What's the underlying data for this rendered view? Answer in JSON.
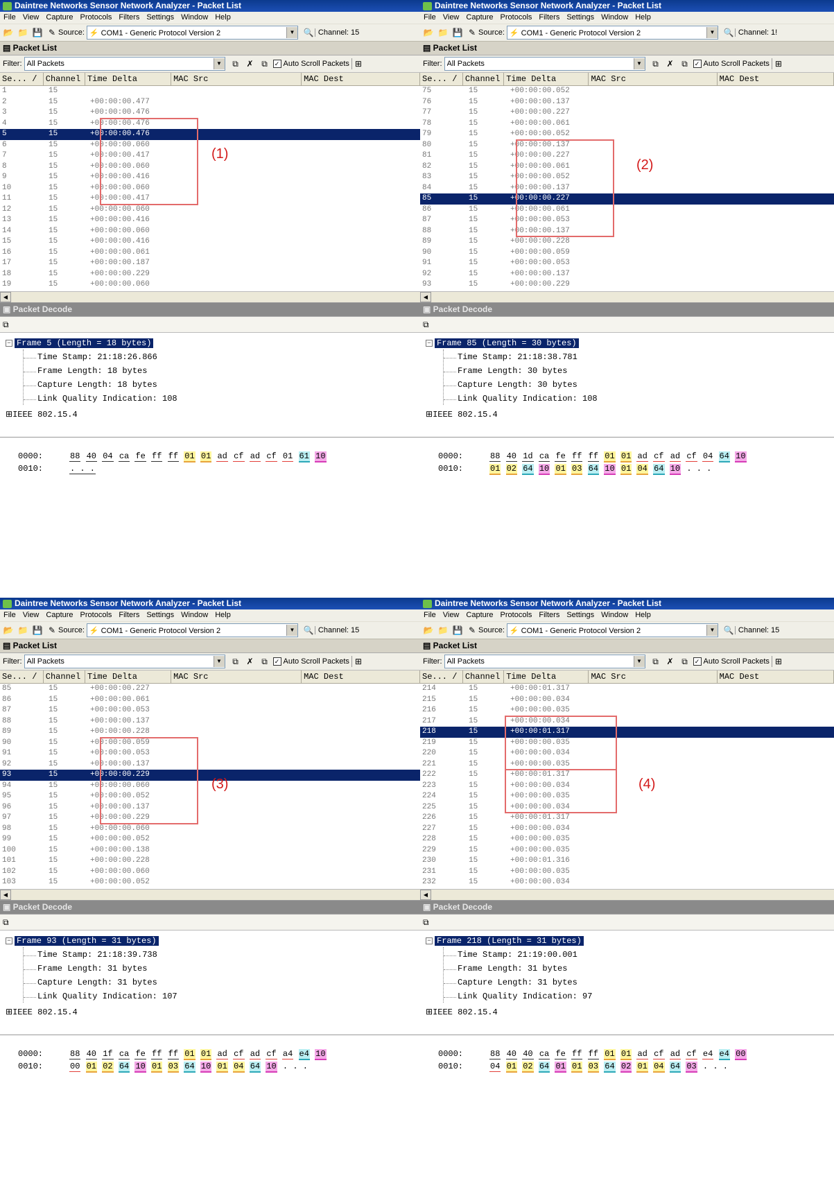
{
  "window": {
    "title": "Daintree Networks Sensor Network Analyzer - Packet List",
    "menu": [
      "File",
      "View",
      "Capture",
      "Protocols",
      "Filters",
      "Settings",
      "Window",
      "Help"
    ],
    "source_label": "Source:",
    "source_value": "COM1 - Generic Protocol Version 2",
    "channel_label": "Channel:"
  },
  "labels": {
    "packet_list": "Packet List",
    "filter_label": "Filter:",
    "filter_value": "All Packets",
    "auto_scroll": "Auto Scroll Packets",
    "packet_decode": "Packet Decode",
    "columns": [
      "Se... /",
      "Channel",
      "Time Delta",
      "MAC Src",
      "MAC Dest"
    ],
    "ieee": "IEEE 802.15.4"
  },
  "panels": [
    {
      "channel_cut": "15",
      "annotation": "(1)",
      "rows": [
        [
          "1",
          "15",
          ""
        ],
        [
          "2",
          "15",
          "+00:00:00.477"
        ],
        [
          "3",
          "15",
          "+00:00:00.476"
        ],
        [
          "4",
          "15",
          "+00:00:00.476"
        ],
        [
          "5",
          "15",
          "+00:00:00.476"
        ],
        [
          "6",
          "15",
          "+00:00:00.060"
        ],
        [
          "7",
          "15",
          "+00:00:00.417"
        ],
        [
          "8",
          "15",
          "+00:00:00.060"
        ],
        [
          "9",
          "15",
          "+00:00:00.416"
        ],
        [
          "10",
          "15",
          "+00:00:00.060"
        ],
        [
          "11",
          "15",
          "+00:00:00.417"
        ],
        [
          "12",
          "15",
          "+00:00:00.060"
        ],
        [
          "13",
          "15",
          "+00:00:00.416"
        ],
        [
          "14",
          "15",
          "+00:00:00.060"
        ],
        [
          "15",
          "15",
          "+00:00:00.416"
        ],
        [
          "16",
          "15",
          "+00:00:00.061"
        ],
        [
          "17",
          "15",
          "+00:00:00.187"
        ],
        [
          "18",
          "15",
          "+00:00:00.229"
        ],
        [
          "19",
          "15",
          "+00:00:00.060"
        ]
      ],
      "selected": 4,
      "frame": "Frame 5 (Length = 18 bytes)",
      "fields": [
        "Time Stamp: 21:18:26.866",
        "Frame Length: 18 bytes",
        "Capture Length: 18 bytes",
        "Link Quality Indication: 108"
      ],
      "hex": [
        {
          "off": "0000:",
          "bytes": [
            [
              "88",
              "u"
            ],
            [
              "40",
              "u"
            ],
            [
              "04",
              "u"
            ],
            [
              "ca",
              "u"
            ],
            [
              "fe",
              "u"
            ],
            [
              "ff",
              "u"
            ],
            [
              "ff",
              "u"
            ],
            [
              "01",
              "y"
            ],
            [
              "01",
              "y"
            ],
            [
              "ad",
              "ur"
            ],
            [
              "cf",
              "ur"
            ],
            [
              "ad",
              "ur"
            ],
            [
              "cf",
              "ur"
            ],
            [
              "01",
              "ur"
            ],
            [
              "61",
              "cy"
            ],
            [
              "10",
              "pk"
            ]
          ]
        },
        {
          "off": "0010:",
          "bytes": [
            [
              ". . .",
              "u"
            ]
          ]
        }
      ]
    },
    {
      "channel_cut": "1!",
      "annotation": "(2)",
      "rows": [
        [
          "75",
          "15",
          "+00:00:00.052"
        ],
        [
          "76",
          "15",
          "+00:00:00.137"
        ],
        [
          "77",
          "15",
          "+00:00:00.227"
        ],
        [
          "78",
          "15",
          "+00:00:00.061"
        ],
        [
          "79",
          "15",
          "+00:00:00.052"
        ],
        [
          "80",
          "15",
          "+00:00:00.137"
        ],
        [
          "81",
          "15",
          "+00:00:00.227"
        ],
        [
          "82",
          "15",
          "+00:00:00.061"
        ],
        [
          "83",
          "15",
          "+00:00:00.052"
        ],
        [
          "84",
          "15",
          "+00:00:00.137"
        ],
        [
          "85",
          "15",
          "+00:00:00.227"
        ],
        [
          "86",
          "15",
          "+00:00:00.061"
        ],
        [
          "87",
          "15",
          "+00:00:00.053"
        ],
        [
          "88",
          "15",
          "+00:00:00.137"
        ],
        [
          "89",
          "15",
          "+00:00:00.228"
        ],
        [
          "90",
          "15",
          "+00:00:00.059"
        ],
        [
          "91",
          "15",
          "+00:00:00.053"
        ],
        [
          "92",
          "15",
          "+00:00:00.137"
        ],
        [
          "93",
          "15",
          "+00:00:00.229"
        ]
      ],
      "selected": 10,
      "frame": "Frame 85 (Length = 30 bytes)",
      "fields": [
        "Time Stamp: 21:18:38.781",
        "Frame Length: 30 bytes",
        "Capture Length: 30 bytes",
        "Link Quality Indication: 108"
      ],
      "hex": [
        {
          "off": "0000:",
          "bytes": [
            [
              "88",
              "u"
            ],
            [
              "40",
              "u"
            ],
            [
              "1d",
              "u"
            ],
            [
              "ca",
              "u"
            ],
            [
              "fe",
              "u"
            ],
            [
              "ff",
              "u"
            ],
            [
              "ff",
              "u"
            ],
            [
              "01",
              "y"
            ],
            [
              "01",
              "y"
            ],
            [
              "ad",
              "ur"
            ],
            [
              "cf",
              "ur"
            ],
            [
              "ad",
              "ur"
            ],
            [
              "cf",
              "ur"
            ],
            [
              "04",
              "ur"
            ],
            [
              "64",
              "cy"
            ],
            [
              "10",
              "pk"
            ]
          ]
        },
        {
          "off": "0010:",
          "bytes": [
            [
              "01",
              "y"
            ],
            [
              "02",
              "y"
            ],
            [
              "64",
              "cy"
            ],
            [
              "10",
              "pk"
            ],
            [
              "01",
              "y"
            ],
            [
              "03",
              "y"
            ],
            [
              "64",
              "cy"
            ],
            [
              "10",
              "pk"
            ],
            [
              "01",
              "y"
            ],
            [
              "04",
              "y"
            ],
            [
              "64",
              "cy"
            ],
            [
              "10",
              "pk"
            ],
            [
              ". . .",
              ""
            ]
          ]
        }
      ]
    },
    {
      "channel_cut": "15",
      "annotation": "(3)",
      "rows": [
        [
          "85",
          "15",
          "+00:00:00.227"
        ],
        [
          "86",
          "15",
          "+00:00:00.061"
        ],
        [
          "87",
          "15",
          "+00:00:00.053"
        ],
        [
          "88",
          "15",
          "+00:00:00.137"
        ],
        [
          "89",
          "15",
          "+00:00:00.228"
        ],
        [
          "90",
          "15",
          "+00:00:00.059"
        ],
        [
          "91",
          "15",
          "+00:00:00.053"
        ],
        [
          "92",
          "15",
          "+00:00:00.137"
        ],
        [
          "93",
          "15",
          "+00:00:00.229"
        ],
        [
          "94",
          "15",
          "+00:00:00.060"
        ],
        [
          "95",
          "15",
          "+00:00:00.052"
        ],
        [
          "96",
          "15",
          "+00:00:00.137"
        ],
        [
          "97",
          "15",
          "+00:00:00.229"
        ],
        [
          "98",
          "15",
          "+00:00:00.060"
        ],
        [
          "99",
          "15",
          "+00:00:00.052"
        ],
        [
          "100",
          "15",
          "+00:00:00.138"
        ],
        [
          "101",
          "15",
          "+00:00:00.228"
        ],
        [
          "102",
          "15",
          "+00:00:00.060"
        ],
        [
          "103",
          "15",
          "+00:00:00.052"
        ]
      ],
      "selected": 8,
      "frame": "Frame 93 (Length = 31 bytes)",
      "fields": [
        "Time Stamp: 21:18:39.738",
        "Frame Length: 31 bytes",
        "Capture Length: 31 bytes",
        "Link Quality Indication: 107"
      ],
      "hex": [
        {
          "off": "0000:",
          "bytes": [
            [
              "88",
              "u"
            ],
            [
              "40",
              "u"
            ],
            [
              "1f",
              "u"
            ],
            [
              "ca",
              "u"
            ],
            [
              "fe",
              "u"
            ],
            [
              "ff",
              "u"
            ],
            [
              "ff",
              "u"
            ],
            [
              "01",
              "y"
            ],
            [
              "01",
              "y"
            ],
            [
              "ad",
              "ur"
            ],
            [
              "cf",
              "ur"
            ],
            [
              "ad",
              "ur"
            ],
            [
              "cf",
              "ur"
            ],
            [
              "a4",
              "ur"
            ],
            [
              "e4",
              "cy"
            ],
            [
              "10",
              "pk"
            ]
          ]
        },
        {
          "off": "0010:",
          "bytes": [
            [
              "00",
              "ur"
            ],
            [
              "01",
              "y"
            ],
            [
              "02",
              "y"
            ],
            [
              "64",
              "cy"
            ],
            [
              "10",
              "pk"
            ],
            [
              "01",
              "y"
            ],
            [
              "03",
              "y"
            ],
            [
              "64",
              "cy"
            ],
            [
              "10",
              "pk"
            ],
            [
              "01",
              "y"
            ],
            [
              "04",
              "y"
            ],
            [
              "64",
              "cy"
            ],
            [
              "10",
              "pk"
            ],
            [
              ". . .",
              ""
            ]
          ]
        }
      ]
    },
    {
      "channel_cut": "15",
      "annotation": "(4)",
      "rows": [
        [
          "214",
          "15",
          "+00:00:01.317"
        ],
        [
          "215",
          "15",
          "+00:00:00.034"
        ],
        [
          "216",
          "15",
          "+00:00:00.035"
        ],
        [
          "217",
          "15",
          "+00:00:00.034"
        ],
        [
          "218",
          "15",
          "+00:00:01.317"
        ],
        [
          "219",
          "15",
          "+00:00:00.035"
        ],
        [
          "220",
          "15",
          "+00:00:00.034"
        ],
        [
          "221",
          "15",
          "+00:00:00.035"
        ],
        [
          "222",
          "15",
          "+00:00:01.317"
        ],
        [
          "223",
          "15",
          "+00:00:00.034"
        ],
        [
          "224",
          "15",
          "+00:00:00.035"
        ],
        [
          "225",
          "15",
          "+00:00:00.034"
        ],
        [
          "226",
          "15",
          "+00:00:01.317"
        ],
        [
          "227",
          "15",
          "+00:00:00.034"
        ],
        [
          "228",
          "15",
          "+00:00:00.035"
        ],
        [
          "229",
          "15",
          "+00:00:00.035"
        ],
        [
          "230",
          "15",
          "+00:00:01.316"
        ],
        [
          "231",
          "15",
          "+00:00:00.035"
        ],
        [
          "232",
          "15",
          "+00:00:00.034"
        ]
      ],
      "selected": 4,
      "frame": "Frame 218 (Length = 31 bytes)",
      "fields": [
        "Time Stamp: 21:19:00.001",
        "Frame Length: 31 bytes",
        "Capture Length: 31 bytes",
        "Link Quality Indication: 97"
      ],
      "hex": [
        {
          "off": "0000:",
          "bytes": [
            [
              "88",
              "u"
            ],
            [
              "40",
              "u"
            ],
            [
              "40",
              "u"
            ],
            [
              "ca",
              "u"
            ],
            [
              "fe",
              "u"
            ],
            [
              "ff",
              "u"
            ],
            [
              "ff",
              "u"
            ],
            [
              "01",
              "y"
            ],
            [
              "01",
              "y"
            ],
            [
              "ad",
              "ur"
            ],
            [
              "cf",
              "ur"
            ],
            [
              "ad",
              "ur"
            ],
            [
              "cf",
              "ur"
            ],
            [
              "e4",
              "ur"
            ],
            [
              "e4",
              "cy"
            ],
            [
              "00",
              "pk"
            ]
          ]
        },
        {
          "off": "0010:",
          "bytes": [
            [
              "04",
              "ur"
            ],
            [
              "01",
              "y"
            ],
            [
              "02",
              "y"
            ],
            [
              "64",
              "cy"
            ],
            [
              "01",
              "pk"
            ],
            [
              "01",
              "y"
            ],
            [
              "03",
              "y"
            ],
            [
              "64",
              "cy"
            ],
            [
              "02",
              "pk"
            ],
            [
              "01",
              "y"
            ],
            [
              "04",
              "y"
            ],
            [
              "64",
              "cy"
            ],
            [
              "03",
              "pk"
            ],
            [
              ". . .",
              ""
            ]
          ]
        }
      ]
    }
  ]
}
